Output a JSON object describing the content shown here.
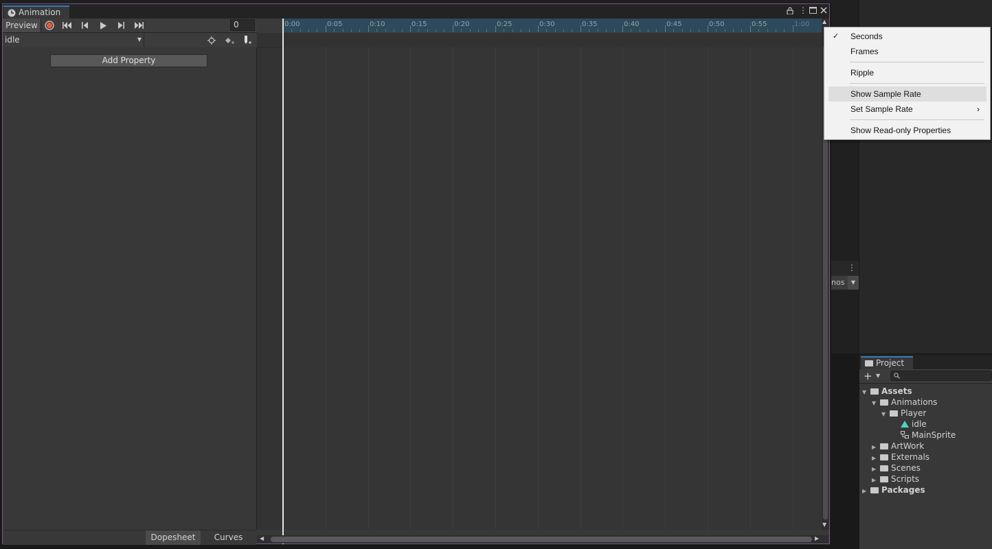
{
  "animation_window": {
    "title": "Animation",
    "toolbar": {
      "preview_label": "Preview",
      "frame_value": "0"
    },
    "clip_selector": {
      "value": "idle"
    },
    "add_property_label": "Add Property",
    "timeline": {
      "tick_labels": [
        "0:00",
        "0:05",
        "0:10",
        "0:15",
        "0:20",
        "0:25",
        "0:30",
        "0:35",
        "0:40",
        "0:45",
        "0:50",
        "0:55",
        "1:00"
      ]
    },
    "bottom_tabs": {
      "dopesheet": "Dopesheet",
      "curves": "Curves"
    }
  },
  "context_menu": {
    "items": [
      {
        "label": "Seconds",
        "checked": true
      },
      {
        "label": "Frames",
        "checked": false
      },
      {
        "label": "Ripple",
        "checked": false
      },
      {
        "label": "Show Sample Rate",
        "checked": false,
        "highlighted": true
      },
      {
        "label": "Set Sample Rate",
        "checked": false,
        "submenu": true
      },
      {
        "label": "Show Read-only Properties",
        "checked": false
      }
    ]
  },
  "background_panel": {
    "partial_text": "nos"
  },
  "project_panel": {
    "title": "Project",
    "tree": [
      {
        "label": "Assets",
        "expanded": true
      },
      {
        "label": "Animations",
        "expanded": true
      },
      {
        "label": "Player",
        "expanded": true
      },
      {
        "label": "idle"
      },
      {
        "label": "MainSprite"
      },
      {
        "label": "ArtWork",
        "expanded": false
      },
      {
        "label": "Externals",
        "expanded": false
      },
      {
        "label": "Scenes",
        "expanded": false
      },
      {
        "label": "Scripts",
        "expanded": false
      },
      {
        "label": "Packages",
        "expanded": false
      }
    ]
  },
  "colors": {
    "record_button": "#e05a3a",
    "timeline_ruler": "#2c4a5c",
    "tab_accent": "#3a79bb",
    "window_border": "#7a5a8a",
    "animation_clip_icon": "#4fd1c5"
  }
}
